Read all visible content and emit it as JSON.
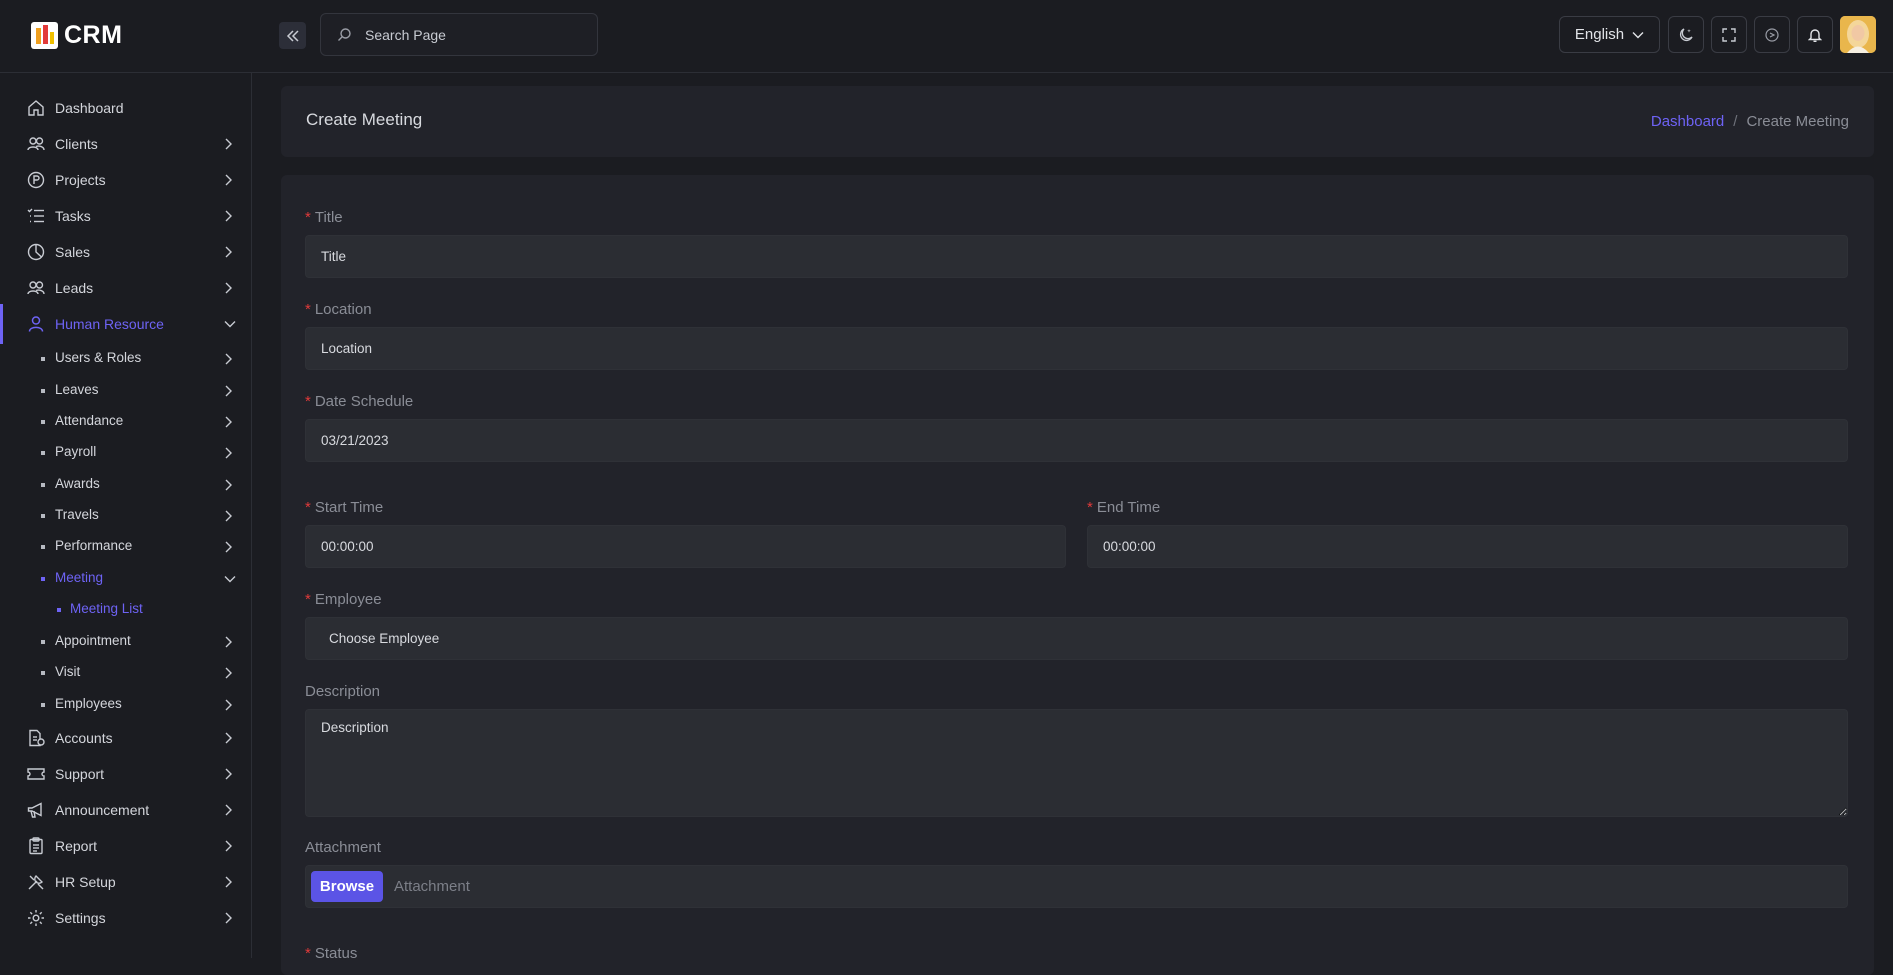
{
  "app": {
    "logo_text": "CRM"
  },
  "header": {
    "search_placeholder": "Search Page",
    "language": "English"
  },
  "sidebar": {
    "items": [
      {
        "label": "Dashboard",
        "icon": "home-icon"
      },
      {
        "label": "Clients",
        "icon": "users-icon"
      },
      {
        "label": "Projects",
        "icon": "projects-icon"
      },
      {
        "label": "Tasks",
        "icon": "tasks-icon"
      },
      {
        "label": "Sales",
        "icon": "pie-chart-icon"
      },
      {
        "label": "Leads",
        "icon": "users-icon"
      },
      {
        "label": "Human Resource",
        "icon": "user-icon"
      },
      {
        "label": "Accounts",
        "icon": "accounts-icon"
      },
      {
        "label": "Support",
        "icon": "ticket-icon"
      },
      {
        "label": "Announcement",
        "icon": "megaphone-icon"
      },
      {
        "label": "Report",
        "icon": "clipboard-icon"
      },
      {
        "label": "HR Setup",
        "icon": "tools-icon"
      },
      {
        "label": "Settings",
        "icon": "gear-icon"
      }
    ],
    "hr_subitems": [
      {
        "label": "Users & Roles"
      },
      {
        "label": "Leaves"
      },
      {
        "label": "Attendance"
      },
      {
        "label": "Payroll"
      },
      {
        "label": "Awards"
      },
      {
        "label": "Travels"
      },
      {
        "label": "Performance"
      },
      {
        "label": "Meeting"
      },
      {
        "label": "Appointment"
      },
      {
        "label": "Visit"
      },
      {
        "label": "Employees"
      }
    ],
    "meeting_subitems": [
      {
        "label": "Meeting List"
      }
    ]
  },
  "page": {
    "title": "Create Meeting",
    "breadcrumb": {
      "home": "Dashboard",
      "separator": "/",
      "current": "Create Meeting"
    }
  },
  "form": {
    "title": {
      "label": "Title",
      "placeholder": "Title"
    },
    "location": {
      "label": "Location",
      "placeholder": "Location"
    },
    "date_schedule": {
      "label": "Date Schedule",
      "value": "03/21/2023"
    },
    "start_time": {
      "label": "Start Time",
      "value": "00:00:00"
    },
    "end_time": {
      "label": "End Time",
      "value": "00:00:00"
    },
    "employee": {
      "label": "Employee",
      "selected": "Choose Employee"
    },
    "description": {
      "label": "Description",
      "placeholder": "Description"
    },
    "attachment": {
      "label": "Attachment",
      "button": "Browse",
      "placeholder": "Attachment"
    },
    "status": {
      "label": "Status"
    },
    "required_mark": "*"
  },
  "colors": {
    "accent": "#6e63f5",
    "required": "#e03a3a",
    "background": "#1b1c21",
    "card": "#22232a",
    "input": "#2b2d33"
  }
}
